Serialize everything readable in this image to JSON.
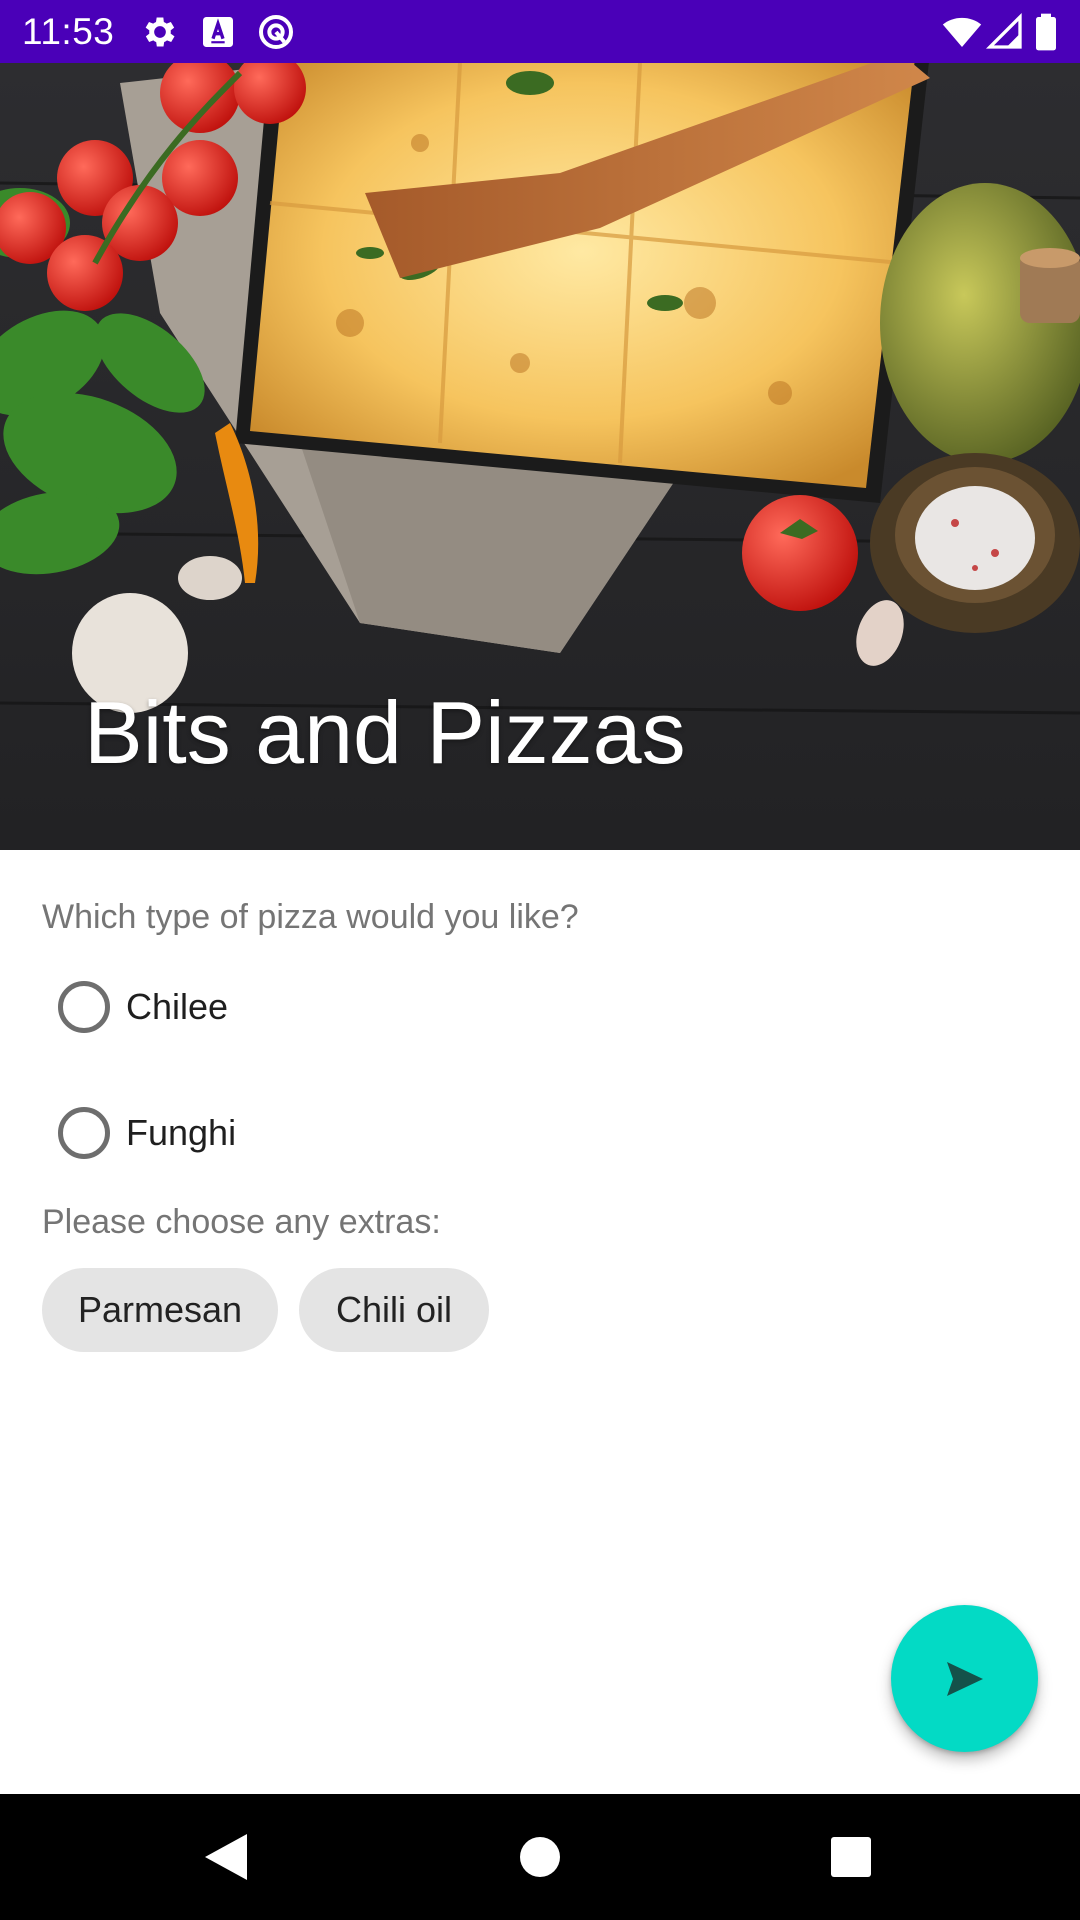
{
  "status_bar": {
    "time": "11:53",
    "background": "#4a00b8",
    "icons": [
      "settings-icon",
      "keyboard-a-icon",
      "accessibility-icon",
      "wifi-icon",
      "signal-icon",
      "battery-icon"
    ]
  },
  "header": {
    "title": "Bits and Pizzas",
    "image": "pizza-photo"
  },
  "form": {
    "pizza_question": "Which type of pizza would you like?",
    "pizza_options": [
      {
        "label": "Chilee",
        "selected": false
      },
      {
        "label": "Funghi",
        "selected": false
      }
    ],
    "extras_question": "Please choose any extras:",
    "extras": [
      {
        "label": "Parmesan"
      },
      {
        "label": "Chili oil"
      }
    ]
  },
  "fab": {
    "icon": "send-icon",
    "color": "#03dac5"
  },
  "nav_bar": {
    "icons": [
      "back-icon",
      "home-icon",
      "recents-icon"
    ]
  }
}
